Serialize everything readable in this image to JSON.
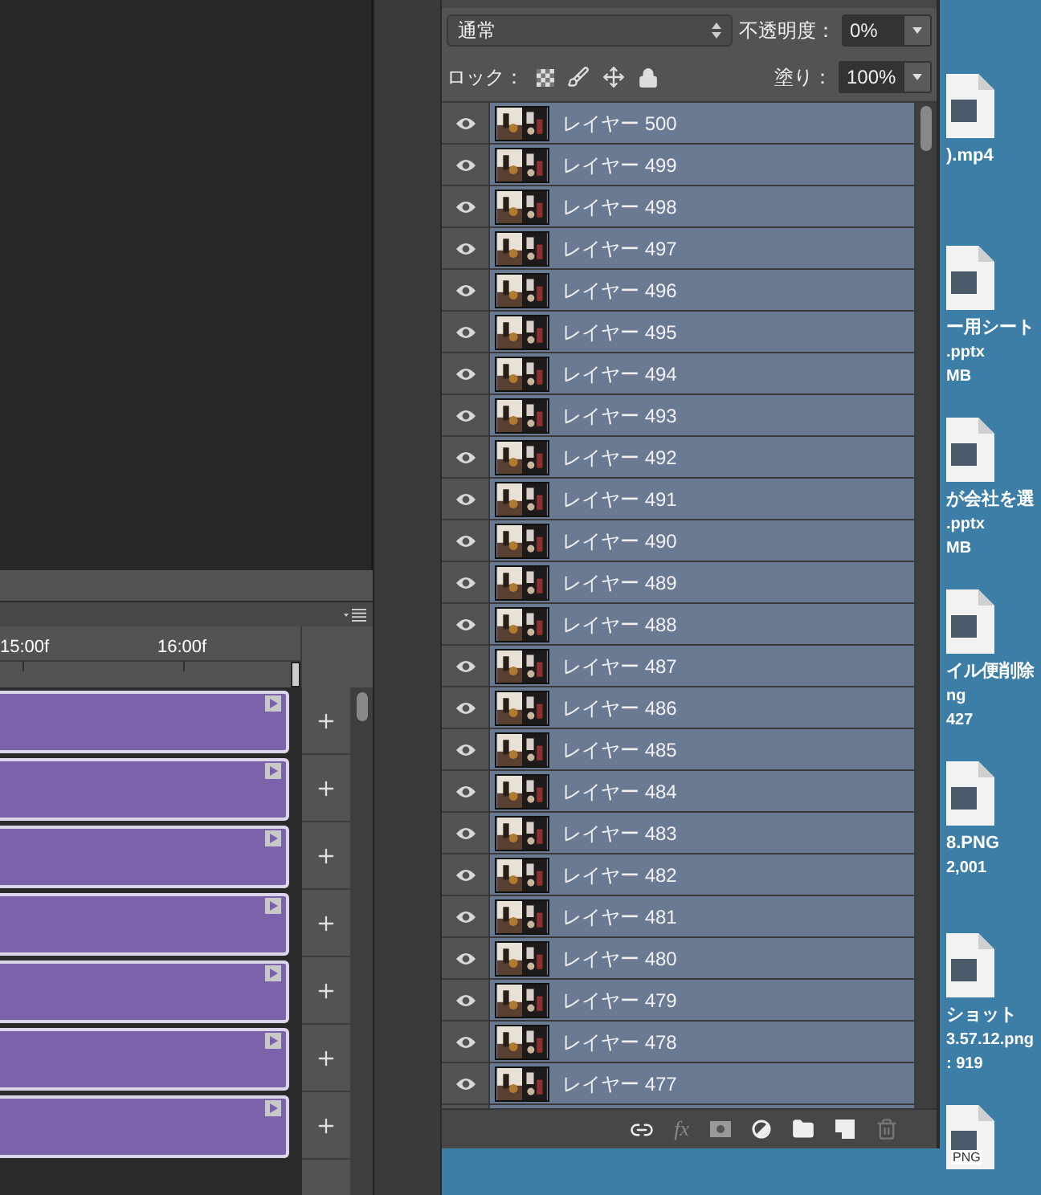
{
  "blend_mode": {
    "value": "通常"
  },
  "opacity": {
    "label": "不透明度：",
    "value": "0%"
  },
  "lock": {
    "label": "ロック："
  },
  "fill": {
    "label": "塗り：",
    "value": "100%"
  },
  "layers": [
    {
      "name": "レイヤー 500",
      "visible": true,
      "selected": true
    },
    {
      "name": "レイヤー 499",
      "visible": true,
      "selected": true
    },
    {
      "name": "レイヤー 498",
      "visible": true,
      "selected": true
    },
    {
      "name": "レイヤー 497",
      "visible": true,
      "selected": true
    },
    {
      "name": "レイヤー 496",
      "visible": true,
      "selected": true
    },
    {
      "name": "レイヤー 495",
      "visible": true,
      "selected": true
    },
    {
      "name": "レイヤー 494",
      "visible": true,
      "selected": true
    },
    {
      "name": "レイヤー 493",
      "visible": true,
      "selected": true
    },
    {
      "name": "レイヤー 492",
      "visible": true,
      "selected": true
    },
    {
      "name": "レイヤー 491",
      "visible": true,
      "selected": true
    },
    {
      "name": "レイヤー 490",
      "visible": true,
      "selected": true
    },
    {
      "name": "レイヤー 489",
      "visible": true,
      "selected": true
    },
    {
      "name": "レイヤー 488",
      "visible": true,
      "selected": true
    },
    {
      "name": "レイヤー 487",
      "visible": true,
      "selected": true
    },
    {
      "name": "レイヤー 486",
      "visible": true,
      "selected": true
    },
    {
      "name": "レイヤー 485",
      "visible": true,
      "selected": true
    },
    {
      "name": "レイヤー 484",
      "visible": true,
      "selected": true
    },
    {
      "name": "レイヤー 483",
      "visible": true,
      "selected": true
    },
    {
      "name": "レイヤー 482",
      "visible": true,
      "selected": true
    },
    {
      "name": "レイヤー 481",
      "visible": true,
      "selected": true
    },
    {
      "name": "レイヤー 480",
      "visible": true,
      "selected": true
    },
    {
      "name": "レイヤー 479",
      "visible": true,
      "selected": true
    },
    {
      "name": "レイヤー 478",
      "visible": true,
      "selected": true
    },
    {
      "name": "レイヤー 477",
      "visible": true,
      "selected": true
    }
  ],
  "layer_toolbar": {
    "fx": "fx"
  },
  "timeline": {
    "ruler": [
      "15:00f",
      "16:00f"
    ]
  },
  "desktop": [
    {
      "lines": [
        ").mp4"
      ]
    },
    {
      "lines": [
        "ー用シート",
        ".pptx",
        "MB"
      ]
    },
    {
      "lines": [
        "が会社を選",
        ".pptx",
        "MB"
      ]
    },
    {
      "lines": [
        "イル便削除",
        "ng",
        "427"
      ]
    },
    {
      "lines": [
        "8.PNG",
        "2,001"
      ]
    },
    {
      "lines": [
        "ショット",
        "3.57.12.png",
        ": 919"
      ]
    },
    {
      "badge": "PNG"
    }
  ]
}
